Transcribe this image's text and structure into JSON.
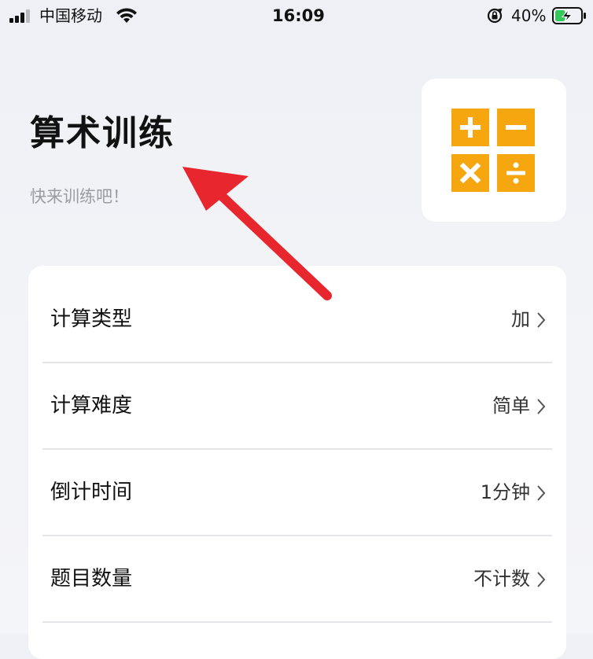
{
  "status_bar": {
    "carrier": "中国移动",
    "time": "16:09",
    "battery_percent": "40%",
    "battery_level": 0.4,
    "charging": true
  },
  "header": {
    "title": "算术训练",
    "subtitle": "快来训练吧！",
    "calculator_icon": "calculator-operators-icon",
    "icon_color": "#f6a60f"
  },
  "settings": {
    "items": [
      {
        "label": "计算类型",
        "value": "加"
      },
      {
        "label": "计算难度",
        "value": "简单"
      },
      {
        "label": "倒计时间",
        "value": "1分钟"
      },
      {
        "label": "题目数量",
        "value": "不计数"
      }
    ]
  },
  "annotation": {
    "arrow_color": "#e8262e"
  }
}
